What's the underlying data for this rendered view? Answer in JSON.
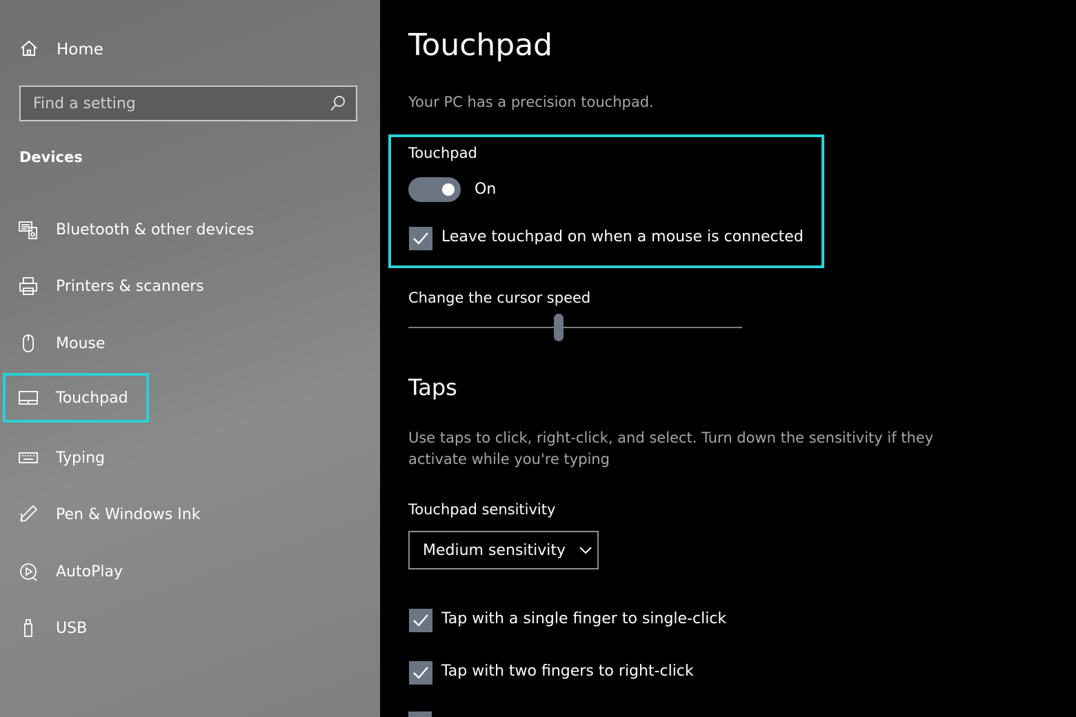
{
  "sidebar": {
    "home_label": "Home",
    "search_placeholder": "Find a setting",
    "section_title": "Devices",
    "items": [
      {
        "label": "Bluetooth & other devices",
        "icon": "bluetooth-devices-icon"
      },
      {
        "label": "Printers & scanners",
        "icon": "printer-icon"
      },
      {
        "label": "Mouse",
        "icon": "mouse-icon"
      },
      {
        "label": "Touchpad",
        "icon": "touchpad-icon",
        "selected": true
      },
      {
        "label": "Typing",
        "icon": "keyboard-icon"
      },
      {
        "label": "Pen & Windows Ink",
        "icon": "pen-icon"
      },
      {
        "label": "AutoPlay",
        "icon": "autoplay-icon"
      },
      {
        "label": "USB",
        "icon": "usb-icon"
      }
    ]
  },
  "main": {
    "title": "Touchpad",
    "subtitle": "Your PC has a precision touchpad.",
    "touchpad_section_label": "Touchpad",
    "toggle_state": "On",
    "toggle_on": true,
    "leave_on_label": "Leave touchpad on when a mouse is connected",
    "leave_on_checked": true,
    "cursor_speed_label": "Change the cursor speed",
    "cursor_speed_fraction": 0.45,
    "taps_title": "Taps",
    "taps_description": "Use taps to click, right-click, and select. Turn down the sensitivity if they activate while you're typing",
    "sensitivity_label": "Touchpad sensitivity",
    "sensitivity_value": "Medium sensitivity",
    "single_tap_label": "Tap with a single finger to single-click",
    "single_tap_checked": true,
    "two_finger_label": "Tap with two fingers to right-click",
    "two_finger_checked": true
  },
  "colors": {
    "accent_highlight": "#2ad0d6",
    "control_fill": "#6c7584",
    "secondary_text": "#a6a6a6"
  }
}
